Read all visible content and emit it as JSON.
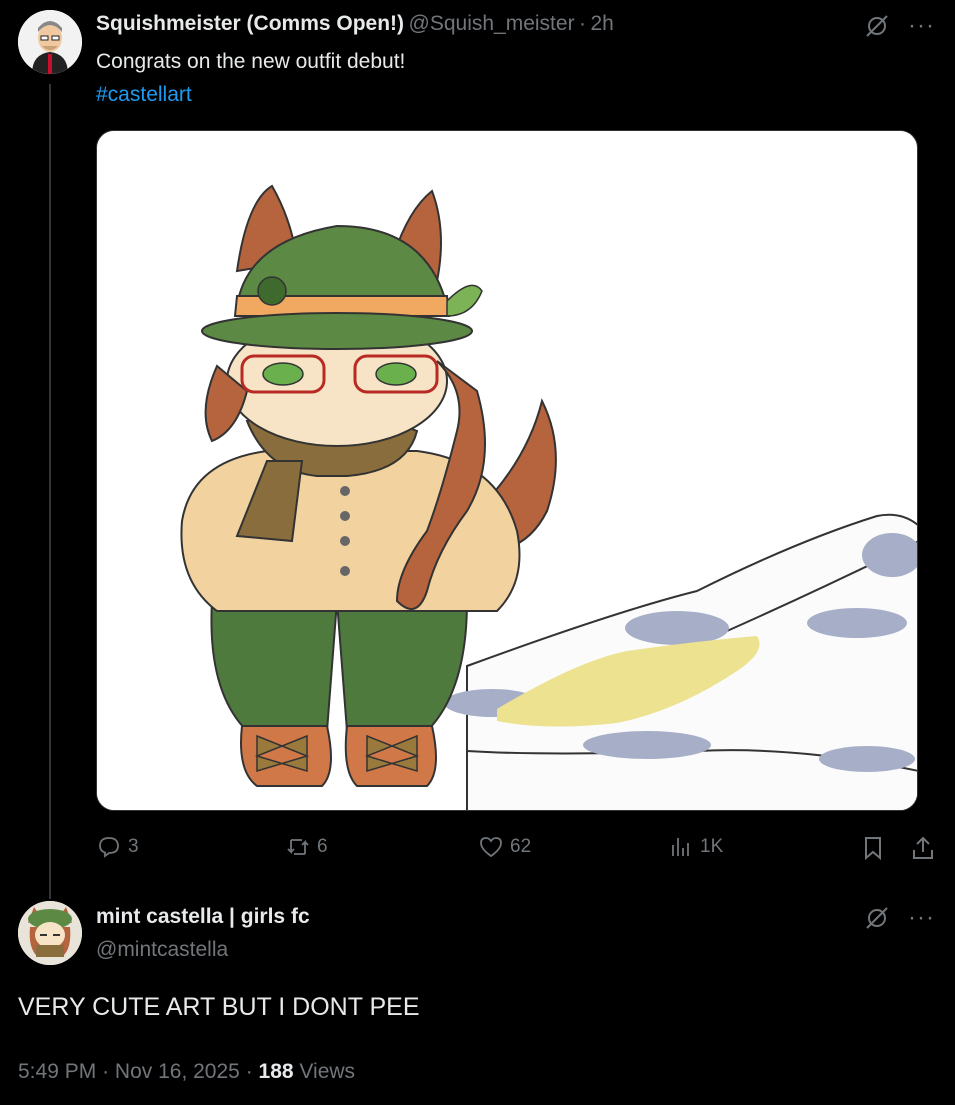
{
  "post1": {
    "author_name": "Squishmeister (Comms Open!)",
    "author_handle": "@Squish_meister",
    "separator": "·",
    "time": "2h",
    "text": "Congrats on the new outfit debut!",
    "hashtag": "#castellart",
    "actions": {
      "replies": "3",
      "reposts": "6",
      "likes": "62",
      "views": "1K"
    },
    "more_label": "···"
  },
  "post2": {
    "author_name": "mint castella | girls fc",
    "author_handle": "@mintcastella",
    "text": "VERY CUTE ART BUT I DONT PEE",
    "time": "5:49 PM",
    "separator": "·",
    "date": "Nov 16, 2025",
    "views_count": "188",
    "views_label": "Views",
    "more_label": "···"
  },
  "icons": {
    "grok": "grok-icon",
    "more": "more-icon",
    "reply": "reply-icon",
    "repost": "repost-icon",
    "like": "heart-icon",
    "views": "analytics-icon",
    "bookmark": "bookmark-icon",
    "share": "share-icon"
  },
  "colors": {
    "background": "#000000",
    "text": "#e7e9ea",
    "muted": "#71767b",
    "link": "#1d9bf0"
  }
}
